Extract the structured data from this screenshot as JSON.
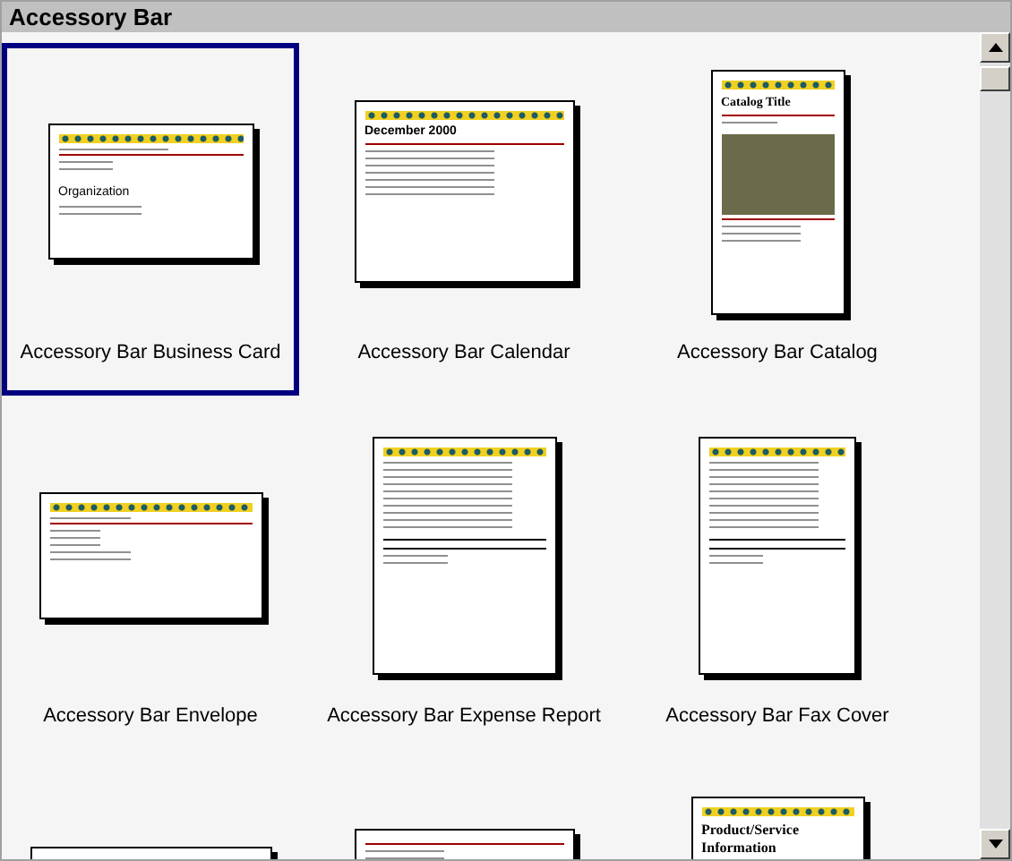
{
  "panel": {
    "title": "Accessory Bar"
  },
  "templates": [
    {
      "label": "Accessory Bar Business Card",
      "selected": true,
      "kind": "card",
      "heading": "Organization"
    },
    {
      "label": "Accessory Bar Calendar",
      "selected": false,
      "kind": "calendar",
      "heading": "December 2000"
    },
    {
      "label": "Accessory Bar Catalog",
      "selected": false,
      "kind": "catalog",
      "heading": "Catalog Title"
    },
    {
      "label": "Accessory Bar Envelope",
      "selected": false,
      "kind": "envelope"
    },
    {
      "label": "Accessory Bar Expense Report",
      "selected": false,
      "kind": "report"
    },
    {
      "label": "Accessory Bar Fax Cover",
      "selected": false,
      "kind": "fax"
    },
    {
      "selected": false,
      "kind": "wide"
    },
    {
      "selected": false,
      "kind": "flyer"
    },
    {
      "selected": false,
      "kind": "info",
      "heading": "Product/Service Information"
    }
  ]
}
